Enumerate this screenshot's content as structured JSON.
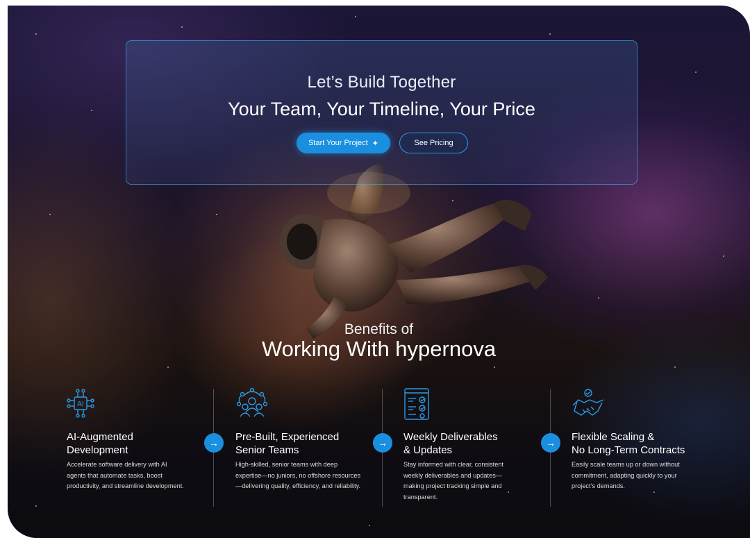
{
  "cta": {
    "kicker": "Let’s Build Together",
    "title": "Your Team, Your Timeline, Your Price",
    "primary_label": "Start Your Project",
    "secondary_label": "See Pricing"
  },
  "benefits": {
    "kicker": "Benefits of",
    "title": "Working With hypernova",
    "items": [
      {
        "title_line1": "AI-Augmented",
        "title_line2": "Development",
        "description": "Accelerate software delivery with AI agents that automate tasks, boost productivity, and streamline development.",
        "icon": "ai-chip-icon"
      },
      {
        "title_line1": "Pre-Built, Experienced",
        "title_line2": "Senior Teams",
        "description": "High-skilled, senior teams with deep expertise—no juniors, no offshore resources—delivering quality, efficiency, and reliability.",
        "icon": "team-network-icon"
      },
      {
        "title_line1": "Weekly Deliverables",
        "title_line2": "& Updates",
        "description": "Stay informed with clear, consistent weekly deliverables and updates—making project tracking simple and transparent.",
        "icon": "checklist-icon"
      },
      {
        "title_line1": "Flexible Scaling &",
        "title_line2": "No Long-Term Contracts",
        "description": "Easily scale teams up or down without commitment, adapting quickly to your project’s demands.",
        "icon": "handshake-icon"
      }
    ]
  },
  "colors": {
    "accent": "#1a8fe0",
    "border": "#3caaf0"
  }
}
